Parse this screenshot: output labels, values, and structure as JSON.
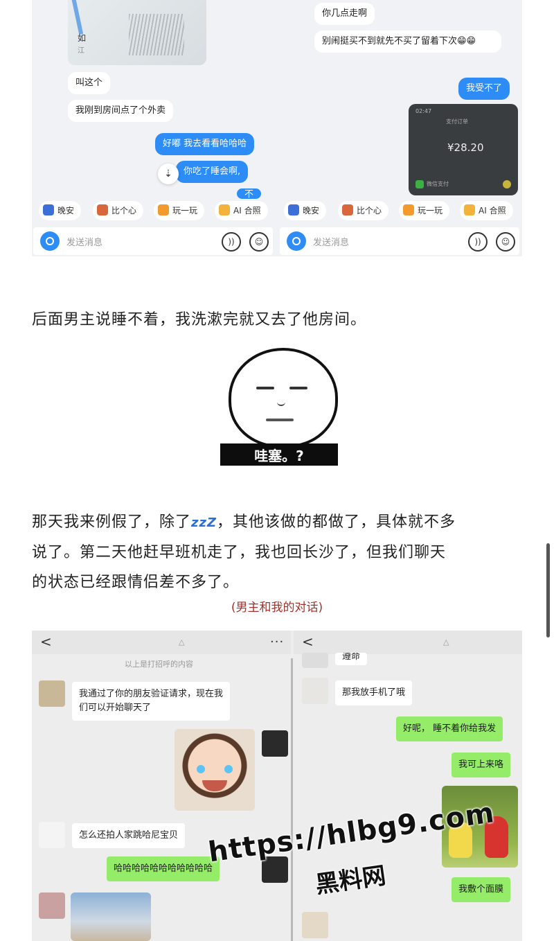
{
  "top_chat": {
    "left": {
      "map_label": "如",
      "map_sub": "江",
      "messages_in": [
        "叫这个",
        "我刚到房间点了个外卖"
      ],
      "messages_out": [
        "好嘟 我去看看哈哈哈",
        "你吃了睡会啊,",
        "不"
      ]
    },
    "right": {
      "messages_in": [
        "你几点走啊",
        "别闹挺买不到就先不买了留着下次😁😁"
      ],
      "messages_out": [
        "我受不了"
      ],
      "pay_card": {
        "time": "02:47",
        "header": "支付订单",
        "amount": "¥28.20",
        "method": "微信支付"
      }
    },
    "quick_actions": [
      "晚安",
      "比个心",
      "玩一玩",
      "AI 合照"
    ],
    "input_placeholder": "发送消息"
  },
  "article": {
    "para1": "后面男主说睡不着，我洗漱完就又去了他房间。",
    "meme_text": "哇塞。?",
    "para2_a": "那天我来例假了，除了",
    "para2_zzz": "zzZ",
    "para2_b": "，其他该做的都做了，具体就不多",
    "para2_line2": "说了。第二天他赶早班机走了，我也回长沙了，但我们聊天",
    "para2_line3": "的状态已经跟情侣差不多了。",
    "caption": "(男主和我的对话)"
  },
  "bottom_chat": {
    "left": {
      "system_note": "以上是打招呼的内容",
      "msg1_line1": "我通过了你的朋友验证请求，现在我",
      "msg1_line2": "们可以开始聊天了",
      "msg2": "怎么还拍人家跳哈尼宝贝",
      "msg3": "哈哈哈哈哈哈哈哈哈哈哈"
    },
    "right": {
      "partial": "遵命",
      "msg_in": "那我放手机了哦",
      "msg_out1": "好呢， 睡不着你给我发",
      "msg_out2": "我可上来咯",
      "msg_out3": "我敷个面膜"
    }
  },
  "watermark": {
    "url": "https://hlbg9.com",
    "name": "黑料网"
  },
  "colors": {
    "qq_blue": "#2e8cf6",
    "wechat_green": "#95ec69",
    "caption_red": "#a3322b"
  }
}
